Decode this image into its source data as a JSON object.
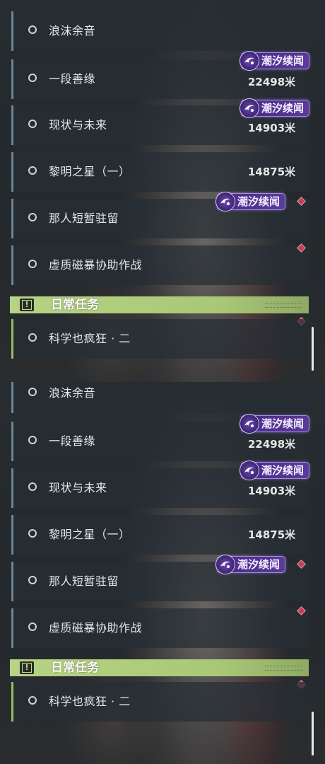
{
  "quest_panels": [
    {
      "quests": [
        {
          "name": "浪沫余音",
          "distance": ""
        },
        {
          "name": "一段善缘",
          "distance": "22498米",
          "tide_badge": "潮汐续闻"
        },
        {
          "name": "现状与未来",
          "distance": "14903米",
          "tide_badge": "潮汐续闻"
        },
        {
          "name": "黎明之星（一）",
          "distance": "14875米"
        },
        {
          "name": "那人短暂驻留",
          "distance": "",
          "tide_badge": "潮汐续闻"
        },
        {
          "name": "虚质磁暴协助作战",
          "distance": ""
        }
      ],
      "daily_section": {
        "title": "日常任务",
        "quests": [
          {
            "name": "科学也疯狂 · 二"
          }
        ]
      }
    },
    {
      "quests": [
        {
          "name": "浪沫余音",
          "distance": ""
        },
        {
          "name": "一段善缘",
          "distance": "22498米",
          "tide_badge": "潮汐续闻"
        },
        {
          "name": "现状与未来",
          "distance": "14903米",
          "tide_badge": "潮汐续闻"
        },
        {
          "name": "黎明之星（一）",
          "distance": "14875米"
        },
        {
          "name": "那人短暂驻留",
          "distance": "",
          "tide_badge": "潮汐续闻"
        },
        {
          "name": "虚质磁暴协助作战",
          "distance": ""
        }
      ],
      "daily_section": {
        "title": "日常任务",
        "quests": [
          {
            "name": "科学也疯狂 · 二"
          }
        ]
      }
    }
  ],
  "icons": {
    "status": "empty-circle-icon",
    "tide": "tide-swirl-icon",
    "marker": "red-diamond-marker-icon",
    "daily": "alert-icon"
  },
  "colors": {
    "tide_badge": "#4a2a86",
    "daily_header": "#b7d385",
    "marker": "#c43e54",
    "main_accent": "#6e8494",
    "daily_accent": "#9cb86a"
  }
}
